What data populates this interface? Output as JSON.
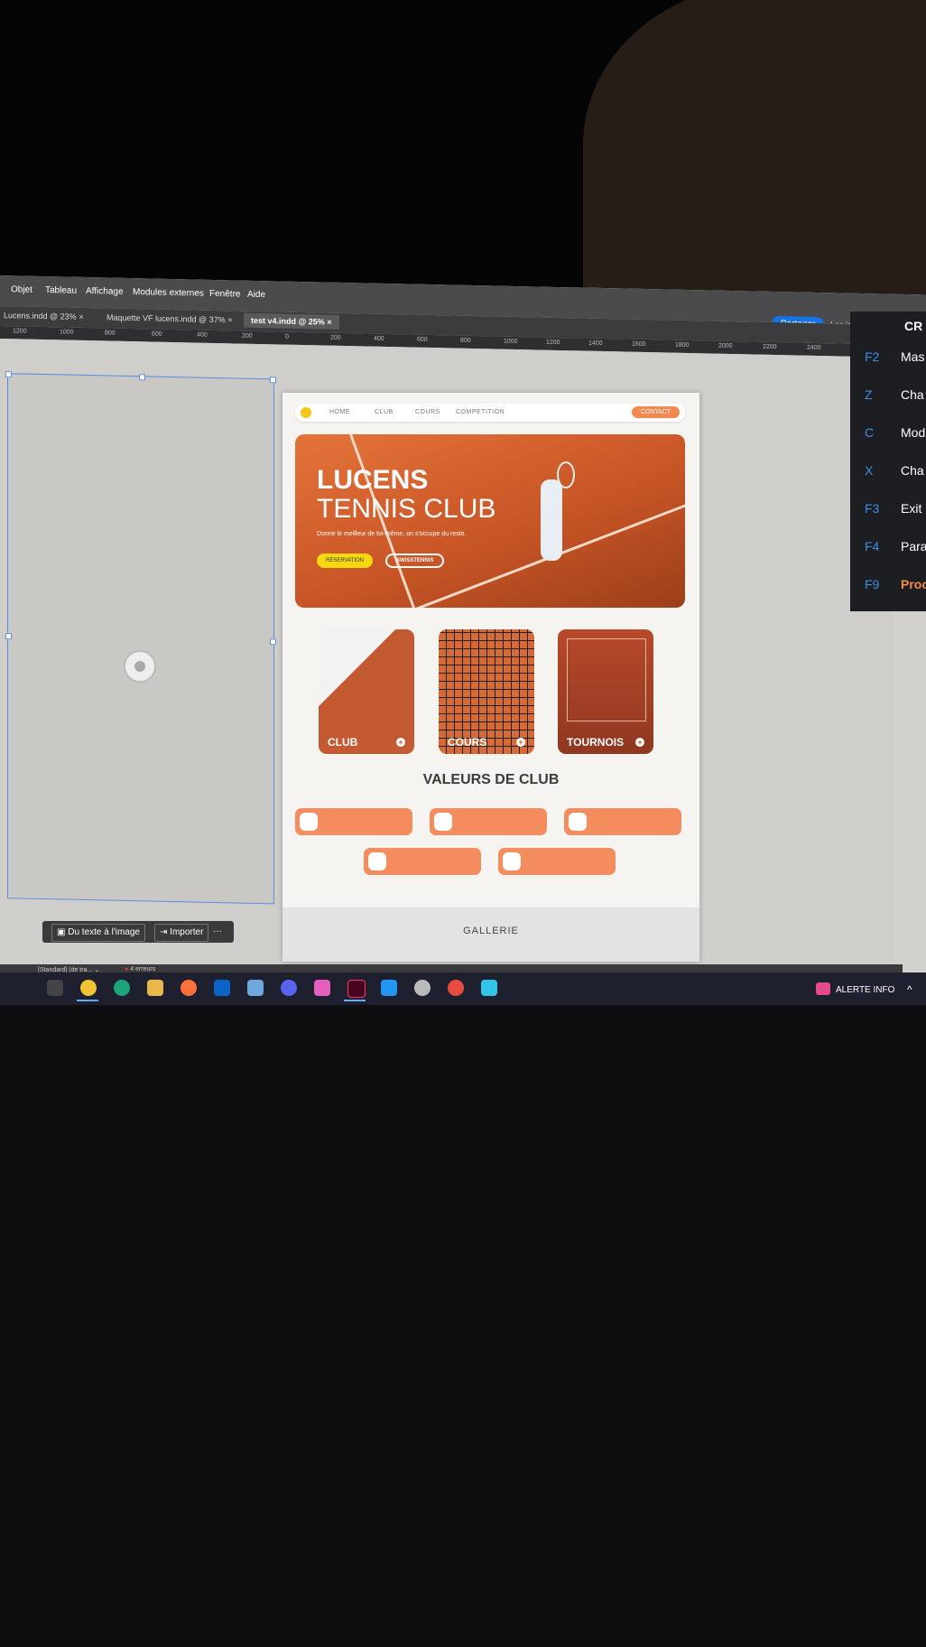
{
  "menu": [
    "Objet",
    "Tableau",
    "Affichage",
    "Modules externes",
    "Fenêtre",
    "Aide"
  ],
  "share_label": "Partager",
  "essentials_label": "Les indispensables",
  "tabs": [
    "Lucens.indd @ 23%",
    "Maquette VF lucens.indd @ 37%",
    "test v4.indd @ 25%"
  ],
  "ruler_marks": [
    "1200",
    "1000",
    "800",
    "600",
    "400",
    "200",
    "0",
    "200",
    "400",
    "600",
    "800",
    "1000",
    "1200",
    "1400",
    "1600",
    "1800",
    "2000",
    "2200",
    "2400"
  ],
  "context_bar": {
    "text_to_image": "Du texte à l'image",
    "import": "Importer",
    "more": "···"
  },
  "site": {
    "nav": {
      "home": "HOME",
      "club": "CLUB",
      "cours": "COURS",
      "competition": "COMPETITION",
      "contact": "CONTACT"
    },
    "hero": {
      "title1": "LUCENS",
      "title2": "TENNIS CLUB",
      "tagline": "Donne le meilleur de toi-même, on s'occupe du reste.",
      "btn_reservation": "RÉSERVATION",
      "btn_swiss": "SWISSTENNIS"
    },
    "cards": [
      "CLUB",
      "COURS",
      "TOURNOIS"
    ],
    "section_title": "VALEURS DE CLUB",
    "gallery_title": "GALLERIE"
  },
  "shortcuts": {
    "title": "CR",
    "items": [
      {
        "key": "F2",
        "label": "Mas"
      },
      {
        "key": "Z",
        "label": "Cha"
      },
      {
        "key": "C",
        "label": "Mod"
      },
      {
        "key": "X",
        "label": "Cha"
      },
      {
        "key": "F3",
        "label": "Exit"
      },
      {
        "key": "F4",
        "label": "Para"
      },
      {
        "key": "F9",
        "label": "Proc"
      }
    ]
  },
  "statusbar": {
    "style": "[Standard] (de tra...",
    "errors": "4 erreurs"
  },
  "taskbar": {
    "alert": "ALERTE INFO"
  },
  "colors": {
    "accent": "#f28a4f",
    "brand_yellow": "#f5d80f",
    "shortcut_key": "#3c8fe6",
    "share": "#1473e6"
  }
}
